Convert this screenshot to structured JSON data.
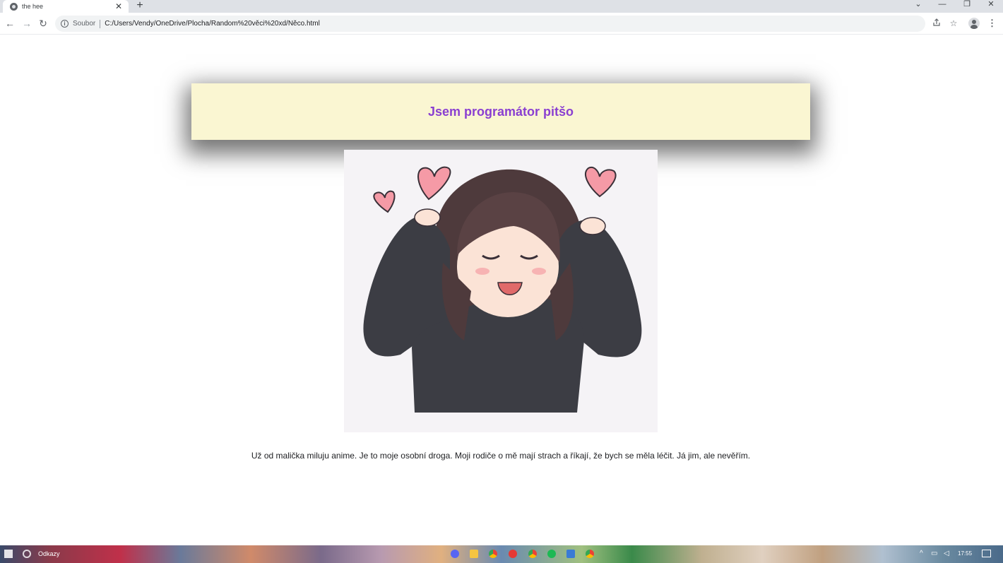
{
  "browser": {
    "tab": {
      "title": "the hee",
      "close_glyph": "✕",
      "favicon": "globe-icon"
    },
    "new_tab_glyph": "+",
    "window_controls": {
      "tab_search": "⌄",
      "minimize": "—",
      "restore": "❐",
      "close": "✕"
    },
    "nav": {
      "back": "←",
      "forward": "→",
      "reload": "↻"
    },
    "address": {
      "info_glyph": "i",
      "scheme_label": "Soubor",
      "url": "C:/Users/Vendy/OneDrive/Plocha/Random%20věci%20xd/Něco.html"
    },
    "toolbar_icons": {
      "share": "share-icon",
      "bookmark": "☆",
      "menu": "⋮"
    }
  },
  "page": {
    "heading": "Jsem programátor pitšo",
    "image_alt": "anime girl in black hoodie with hearts",
    "paragraph": "Už od malička miluju anime. Je to moje osobní droga. Moji rodiče o mě mají strach a říkají, že bych se měla léčit. Já jim, ale nevěřím.",
    "colors": {
      "heading": "#8a3fd1",
      "banner_bg": "#faf6d2",
      "text": "#202124"
    }
  },
  "taskbar": {
    "label": "Odkazy",
    "clock": "17:55",
    "app_icons": [
      "discord-icon",
      "file-explorer-icon",
      "chrome-icon",
      "app-icon",
      "chrome-icon",
      "spotify-icon",
      "app-icon",
      "chrome-icon"
    ]
  }
}
